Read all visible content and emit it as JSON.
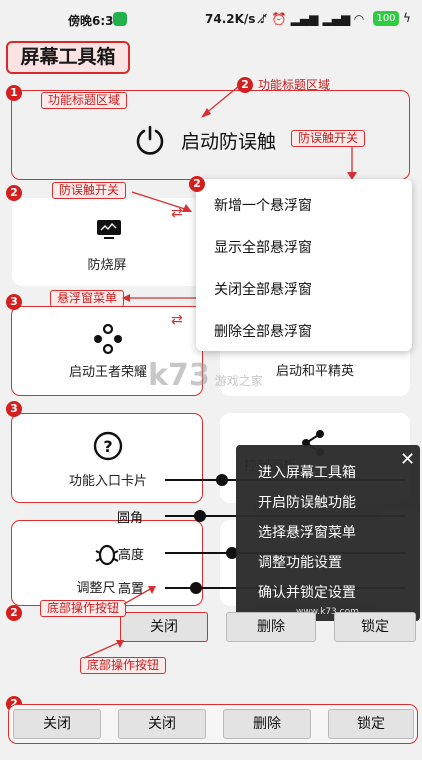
{
  "status": {
    "time": "傍晚6:32",
    "net_info": "74.2K/s",
    "battery": "100"
  },
  "app_title": "屏幕工具箱",
  "annot": {
    "tag_feature_title": "功能标题区域",
    "tag_feature_title_2": "功能标题区域",
    "tag_anti_touch_1": "防误触开关",
    "tag_anti_touch_2": "防误触开关",
    "tag_float_menu": "悬浮窗菜单",
    "tag_bottom_btn_1": "底部操作按钮",
    "tag_bottom_btn_2": "底部操作按钮",
    "badges": [
      "1",
      "2",
      "2",
      "2",
      "3",
      "3",
      "2",
      "2"
    ]
  },
  "title_area": {
    "label": "启动防误触"
  },
  "cards": {
    "burn": "防烧屏",
    "honor": "启动王者荣耀",
    "peace": "启动和平精英",
    "entry": "功能入口卡片",
    "control": "控制面板",
    "adjust": "调整尺"
  },
  "float_menu": [
    "新增一个悬浮窗",
    "显示全部悬浮窗",
    "关闭全部悬浮窗",
    "删除全部悬浮窗"
  ],
  "dark_menu": [
    "进入屏幕工具箱",
    "开启防误触功能",
    "选择悬浮窗菜单",
    "调整功能设置",
    "确认并锁定设置"
  ],
  "dark_menu_url": "www.k73.com",
  "sliders": {
    "corner": "圆角",
    "height": "高度",
    "high": "高置"
  },
  "watermark": {
    "brand": "k73",
    "sub": "游戏之家"
  },
  "mid_buttons": [
    "关闭",
    "删除",
    "锁定"
  ],
  "bottom_buttons": [
    "关闭",
    "关闭",
    "删除",
    "锁定"
  ],
  "colors": {
    "accent_red": "#d83030",
    "menu_dark": "#2b2b2b"
  }
}
